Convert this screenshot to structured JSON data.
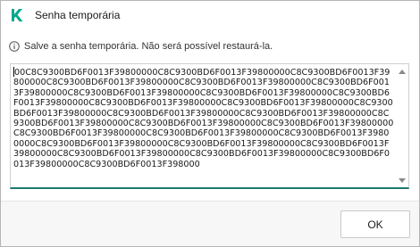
{
  "window": {
    "title": "Senha temporária",
    "logo_icon": "kaspersky-k-logo",
    "accent_color": "#00a88e"
  },
  "info": {
    "icon": "info-circle-icon",
    "message": "Salve a senha temporária. Não será possível restaurá-la."
  },
  "password_field": {
    "value": "00C8C9300BD6F0013F39800000C8C9300BD6F0013F39800000C8C9300BD6F0013F39800000C8C9300BD6F0013F39800000C8C9300BD6F0013F39800000C8C9300BD6F0013F39800000C8C9300BD6F0013F39800000C8C9300BD6F0013F39800000C8C9300BD6F0013F39800000C8C9300BD6F0013F39800000C8C9300BD6F0013F39800000C8C9300BD6F0013F39800000C8C9300BD6F0013F39800000C8C9300BD6F0013F39800000C8C9300BD6F0013F39800000C8C9300BD6F0013F39800000C8C9300BD6F0013F39800000C8C9300BD6F0013F39800000C8C9300BD6F0013F39800000C8C9300BD6F0013F39800000C8C9300BD6F0013F39800000C8C9300BD6F0013F39800000C8C9300BD6F0013F39800000C8C9300BD6F0013F39800000C8C9300BD6F0013F39800000C8C9300BD6F0013F39800000C8C9300BD6F0013F398000"
  },
  "footer": {
    "ok_label": "OK"
  }
}
